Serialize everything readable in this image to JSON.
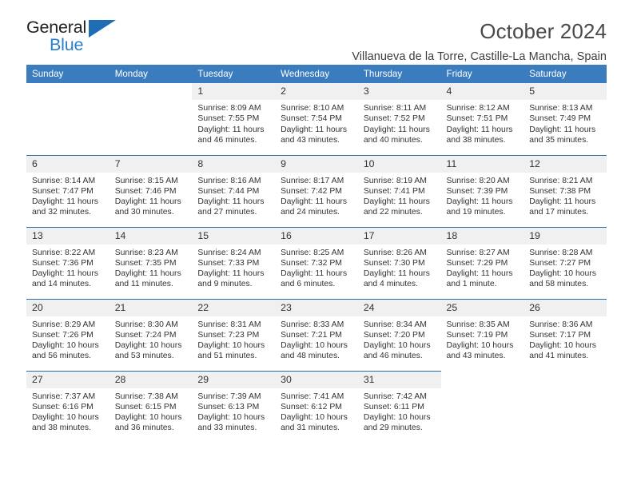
{
  "brand": {
    "name_part1": "General",
    "name_part2": "Blue",
    "accent_color": "#2a7fc9",
    "triangle_color": "#1f6db5"
  },
  "header": {
    "title": "October 2024",
    "location": "Villanueva de la Torre, Castille-La Mancha, Spain"
  },
  "theme": {
    "header_row_bg": "#3a7cbe",
    "row_divider": "#2c6aa8",
    "daynum_bg": "#f0f0f0"
  },
  "calendar": {
    "weekday_headers": [
      "Sunday",
      "Monday",
      "Tuesday",
      "Wednesday",
      "Thursday",
      "Friday",
      "Saturday"
    ],
    "labels": {
      "sunrise": "Sunrise:",
      "sunset": "Sunset:",
      "daylight": "Daylight:"
    },
    "weeks": [
      [
        {
          "empty": true
        },
        {
          "empty": true
        },
        {
          "day": "1",
          "sunrise": "Sunrise: 8:09 AM",
          "sunset": "Sunset: 7:55 PM",
          "daylight_line1": "Daylight: 11 hours",
          "daylight_line2": "and 46 minutes."
        },
        {
          "day": "2",
          "sunrise": "Sunrise: 8:10 AM",
          "sunset": "Sunset: 7:54 PM",
          "daylight_line1": "Daylight: 11 hours",
          "daylight_line2": "and 43 minutes."
        },
        {
          "day": "3",
          "sunrise": "Sunrise: 8:11 AM",
          "sunset": "Sunset: 7:52 PM",
          "daylight_line1": "Daylight: 11 hours",
          "daylight_line2": "and 40 minutes."
        },
        {
          "day": "4",
          "sunrise": "Sunrise: 8:12 AM",
          "sunset": "Sunset: 7:51 PM",
          "daylight_line1": "Daylight: 11 hours",
          "daylight_line2": "and 38 minutes."
        },
        {
          "day": "5",
          "sunrise": "Sunrise: 8:13 AM",
          "sunset": "Sunset: 7:49 PM",
          "daylight_line1": "Daylight: 11 hours",
          "daylight_line2": "and 35 minutes."
        }
      ],
      [
        {
          "day": "6",
          "sunrise": "Sunrise: 8:14 AM",
          "sunset": "Sunset: 7:47 PM",
          "daylight_line1": "Daylight: 11 hours",
          "daylight_line2": "and 32 minutes."
        },
        {
          "day": "7",
          "sunrise": "Sunrise: 8:15 AM",
          "sunset": "Sunset: 7:46 PM",
          "daylight_line1": "Daylight: 11 hours",
          "daylight_line2": "and 30 minutes."
        },
        {
          "day": "8",
          "sunrise": "Sunrise: 8:16 AM",
          "sunset": "Sunset: 7:44 PM",
          "daylight_line1": "Daylight: 11 hours",
          "daylight_line2": "and 27 minutes."
        },
        {
          "day": "9",
          "sunrise": "Sunrise: 8:17 AM",
          "sunset": "Sunset: 7:42 PM",
          "daylight_line1": "Daylight: 11 hours",
          "daylight_line2": "and 24 minutes."
        },
        {
          "day": "10",
          "sunrise": "Sunrise: 8:19 AM",
          "sunset": "Sunset: 7:41 PM",
          "daylight_line1": "Daylight: 11 hours",
          "daylight_line2": "and 22 minutes."
        },
        {
          "day": "11",
          "sunrise": "Sunrise: 8:20 AM",
          "sunset": "Sunset: 7:39 PM",
          "daylight_line1": "Daylight: 11 hours",
          "daylight_line2": "and 19 minutes."
        },
        {
          "day": "12",
          "sunrise": "Sunrise: 8:21 AM",
          "sunset": "Sunset: 7:38 PM",
          "daylight_line1": "Daylight: 11 hours",
          "daylight_line2": "and 17 minutes."
        }
      ],
      [
        {
          "day": "13",
          "sunrise": "Sunrise: 8:22 AM",
          "sunset": "Sunset: 7:36 PM",
          "daylight_line1": "Daylight: 11 hours",
          "daylight_line2": "and 14 minutes."
        },
        {
          "day": "14",
          "sunrise": "Sunrise: 8:23 AM",
          "sunset": "Sunset: 7:35 PM",
          "daylight_line1": "Daylight: 11 hours",
          "daylight_line2": "and 11 minutes."
        },
        {
          "day": "15",
          "sunrise": "Sunrise: 8:24 AM",
          "sunset": "Sunset: 7:33 PM",
          "daylight_line1": "Daylight: 11 hours",
          "daylight_line2": "and 9 minutes."
        },
        {
          "day": "16",
          "sunrise": "Sunrise: 8:25 AM",
          "sunset": "Sunset: 7:32 PM",
          "daylight_line1": "Daylight: 11 hours",
          "daylight_line2": "and 6 minutes."
        },
        {
          "day": "17",
          "sunrise": "Sunrise: 8:26 AM",
          "sunset": "Sunset: 7:30 PM",
          "daylight_line1": "Daylight: 11 hours",
          "daylight_line2": "and 4 minutes."
        },
        {
          "day": "18",
          "sunrise": "Sunrise: 8:27 AM",
          "sunset": "Sunset: 7:29 PM",
          "daylight_line1": "Daylight: 11 hours",
          "daylight_line2": "and 1 minute."
        },
        {
          "day": "19",
          "sunrise": "Sunrise: 8:28 AM",
          "sunset": "Sunset: 7:27 PM",
          "daylight_line1": "Daylight: 10 hours",
          "daylight_line2": "and 58 minutes."
        }
      ],
      [
        {
          "day": "20",
          "sunrise": "Sunrise: 8:29 AM",
          "sunset": "Sunset: 7:26 PM",
          "daylight_line1": "Daylight: 10 hours",
          "daylight_line2": "and 56 minutes."
        },
        {
          "day": "21",
          "sunrise": "Sunrise: 8:30 AM",
          "sunset": "Sunset: 7:24 PM",
          "daylight_line1": "Daylight: 10 hours",
          "daylight_line2": "and 53 minutes."
        },
        {
          "day": "22",
          "sunrise": "Sunrise: 8:31 AM",
          "sunset": "Sunset: 7:23 PM",
          "daylight_line1": "Daylight: 10 hours",
          "daylight_line2": "and 51 minutes."
        },
        {
          "day": "23",
          "sunrise": "Sunrise: 8:33 AM",
          "sunset": "Sunset: 7:21 PM",
          "daylight_line1": "Daylight: 10 hours",
          "daylight_line2": "and 48 minutes."
        },
        {
          "day": "24",
          "sunrise": "Sunrise: 8:34 AM",
          "sunset": "Sunset: 7:20 PM",
          "daylight_line1": "Daylight: 10 hours",
          "daylight_line2": "and 46 minutes."
        },
        {
          "day": "25",
          "sunrise": "Sunrise: 8:35 AM",
          "sunset": "Sunset: 7:19 PM",
          "daylight_line1": "Daylight: 10 hours",
          "daylight_line2": "and 43 minutes."
        },
        {
          "day": "26",
          "sunrise": "Sunrise: 8:36 AM",
          "sunset": "Sunset: 7:17 PM",
          "daylight_line1": "Daylight: 10 hours",
          "daylight_line2": "and 41 minutes."
        }
      ],
      [
        {
          "day": "27",
          "sunrise": "Sunrise: 7:37 AM",
          "sunset": "Sunset: 6:16 PM",
          "daylight_line1": "Daylight: 10 hours",
          "daylight_line2": "and 38 minutes."
        },
        {
          "day": "28",
          "sunrise": "Sunrise: 7:38 AM",
          "sunset": "Sunset: 6:15 PM",
          "daylight_line1": "Daylight: 10 hours",
          "daylight_line2": "and 36 minutes."
        },
        {
          "day": "29",
          "sunrise": "Sunrise: 7:39 AM",
          "sunset": "Sunset: 6:13 PM",
          "daylight_line1": "Daylight: 10 hours",
          "daylight_line2": "and 33 minutes."
        },
        {
          "day": "30",
          "sunrise": "Sunrise: 7:41 AM",
          "sunset": "Sunset: 6:12 PM",
          "daylight_line1": "Daylight: 10 hours",
          "daylight_line2": "and 31 minutes."
        },
        {
          "day": "31",
          "sunrise": "Sunrise: 7:42 AM",
          "sunset": "Sunset: 6:11 PM",
          "daylight_line1": "Daylight: 10 hours",
          "daylight_line2": "and 29 minutes."
        },
        {
          "empty": true
        },
        {
          "empty": true
        }
      ]
    ]
  }
}
